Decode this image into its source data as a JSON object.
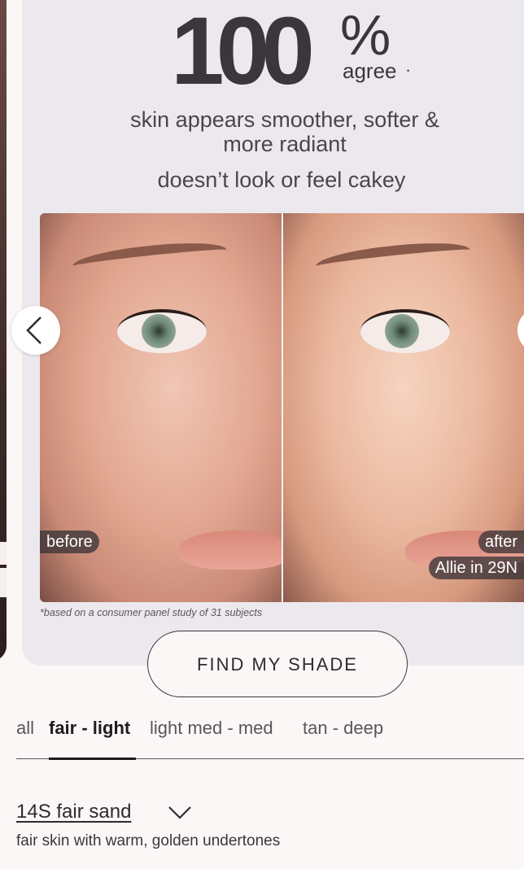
{
  "hero": {
    "big_number": "100",
    "percent_sign": "%",
    "agree_label": "agree",
    "agree_mark": "•",
    "claim_line1": "skin appears smoother, softer &",
    "claim_line2": "more radiant",
    "claim_secondary": "doesn’t look or feel cakey"
  },
  "comparison": {
    "before_label": "before",
    "after_label": "after",
    "subject_label": "Allie in 29N",
    "footnote": "*based on a consumer panel study of 31 subjects"
  },
  "cta": {
    "label": "FIND MY SHADE"
  },
  "shade_tabs": [
    {
      "label": "all",
      "active": false
    },
    {
      "label": "fair - light",
      "active": true
    },
    {
      "label": "light med - med",
      "active": false
    },
    {
      "label": "tan - deep",
      "active": false
    }
  ],
  "shade": {
    "name": "14S fair sand",
    "description": "fair skin with warm, golden undertones"
  },
  "colors": {
    "background": "#fbf7f6",
    "card": "#ece9ee",
    "text": "#2e2b2e",
    "tag_bg": "#3c3437"
  }
}
